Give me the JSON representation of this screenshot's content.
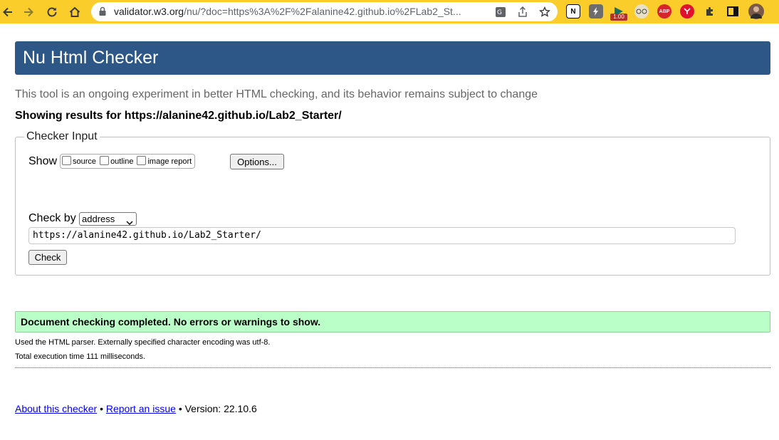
{
  "browser": {
    "url_domain": "validator.w3.org",
    "url_path": "/nu/?doc=https%3A%2F%2Falanine42.github.io%2FLab2_St...",
    "extension_badge": "1.00",
    "extension_abp": "ABP"
  },
  "header": {
    "title": "Nu Html Checker"
  },
  "intro": "This tool is an ongoing experiment in better HTML checking, and its behavior remains subject to change",
  "showing_results": "Showing results for https://alanine42.github.io/Lab2_Starter/",
  "checker_input": {
    "legend": "Checker Input",
    "show_label": "Show",
    "show_options": [
      "source",
      "outline",
      "image report"
    ],
    "options_button": "Options...",
    "check_by_label": "Check by",
    "check_by_value": "address",
    "url_value": "https://alanine42.github.io/Lab2_Starter/",
    "check_button": "Check"
  },
  "result": {
    "success_message": "Document checking completed. No errors or warnings to show.",
    "parser_info": "Used the HTML parser. Externally specified character encoding was utf-8.",
    "execution_time": "Total execution time 111 milliseconds."
  },
  "footer": {
    "about_link": "About this checker",
    "separator": "•",
    "report_link": "Report an issue",
    "version": "Version: 22.10.6"
  }
}
